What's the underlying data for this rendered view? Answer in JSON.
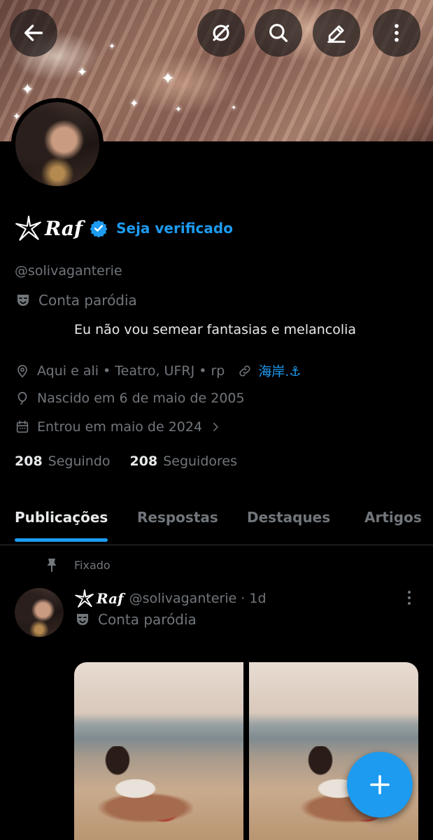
{
  "header": {
    "back_icon": "arrow-left-icon",
    "actions": [
      "grok-icon",
      "search-icon",
      "edit-icon",
      "more-vertical-icon"
    ]
  },
  "profile": {
    "display_name": "Raf",
    "verify_cta": "Seja verificado",
    "handle": "@solivaganterie",
    "parody_label": "Conta paródia",
    "bio": "Eu não vou semear fantasias e melancolia",
    "location": "Aqui e ali • Teatro, UFRJ • rp",
    "link": "海岸.⚓",
    "birth": "Nascido em 6 de maio de 2005",
    "joined": "Entrou em maio de 2024",
    "following_count": "208",
    "following_label": "Seguindo",
    "followers_count": "208",
    "followers_label": "Seguidores"
  },
  "tabs": [
    {
      "label": "Publicações",
      "active": true
    },
    {
      "label": "Respostas",
      "active": false
    },
    {
      "label": "Destaques",
      "active": false
    },
    {
      "label": "Artigos",
      "active": false
    }
  ],
  "pinned_post": {
    "pinned_label": "Fixado",
    "author_name": "Raf",
    "author_handle": "@solivaganterie",
    "time": "· 1d",
    "parody_label": "Conta paródia",
    "media_count": 2
  },
  "colors": {
    "accent": "#1d9bf0",
    "background": "#000000",
    "secondary_text": "#71767b",
    "primary_text": "#e7e9ea"
  },
  "fab": {
    "icon": "plus-icon"
  }
}
